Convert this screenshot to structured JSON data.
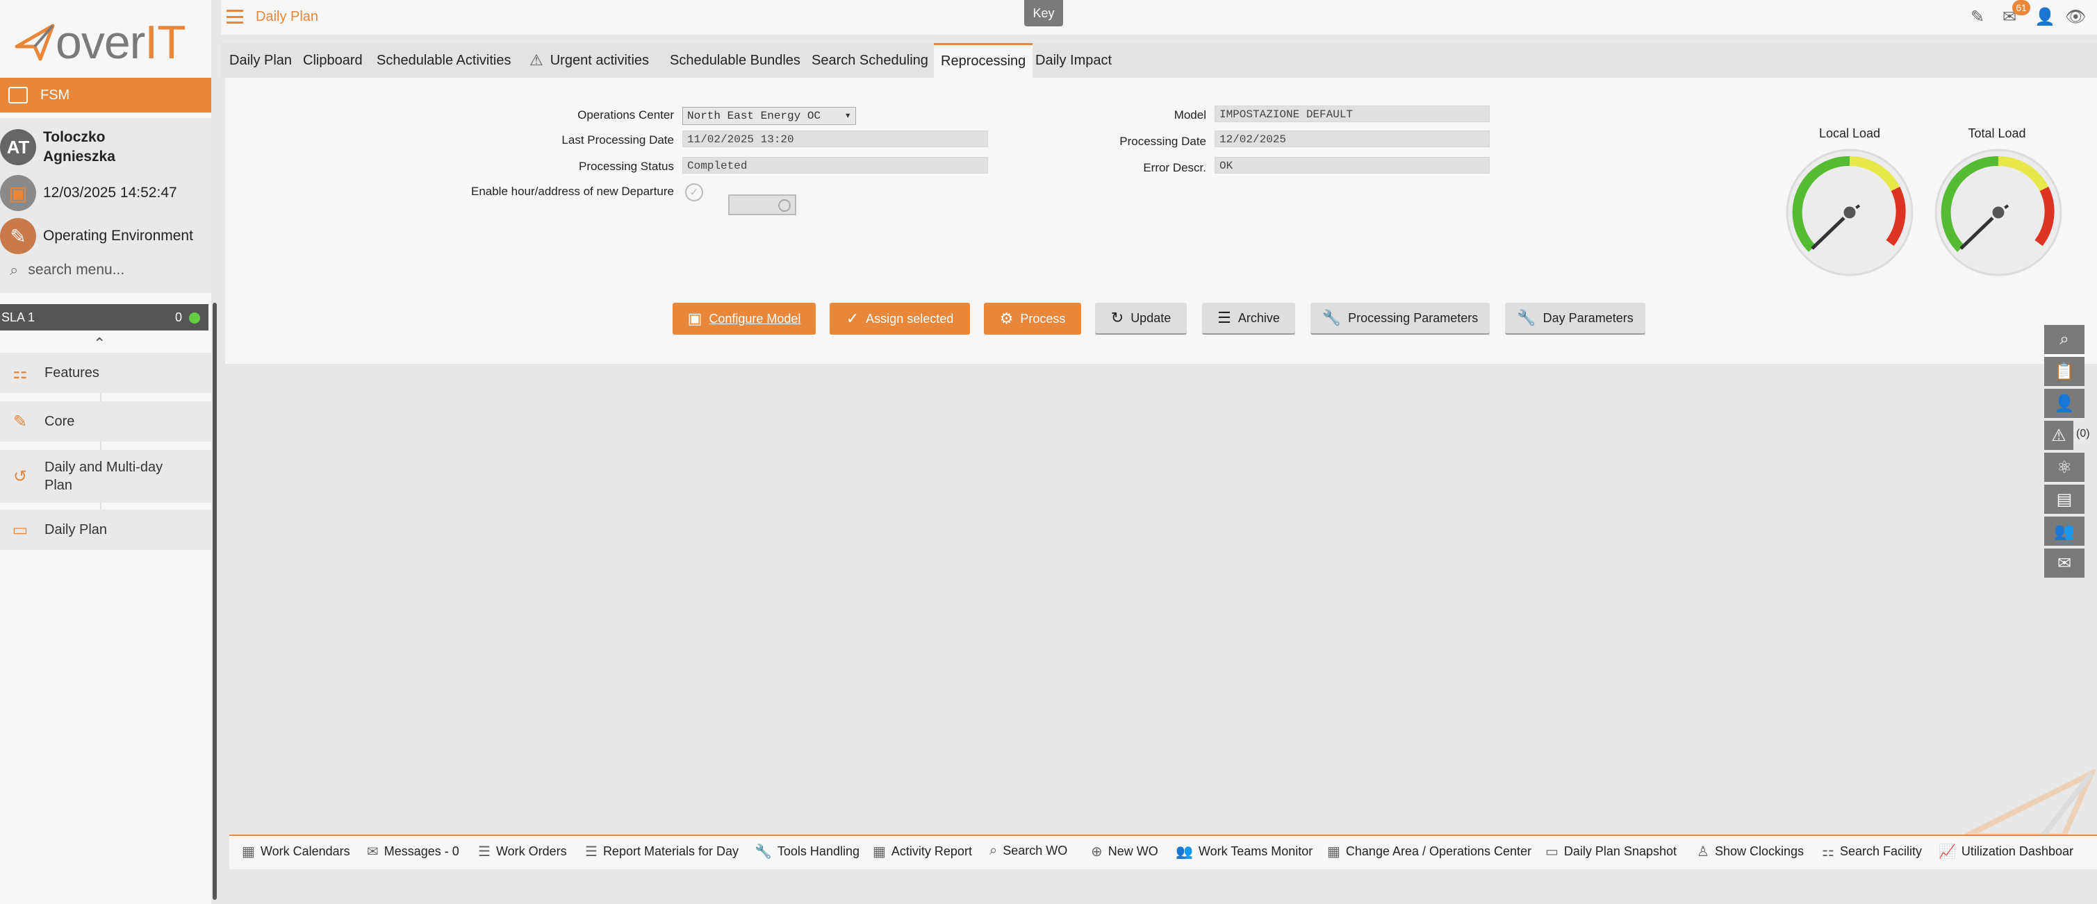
{
  "brand": {
    "logo_main": "over",
    "logo_accent": "IT"
  },
  "sidebar": {
    "module": "FSM",
    "user_initials": "AT",
    "user_name_line1": "Toloczko",
    "user_name_line2": "Agnieszka",
    "datetime": "12/03/2025 14:52:47",
    "environment": "Operating Environment",
    "search_placeholder": "search menu...",
    "sla_label": "SLA 1",
    "sla_count": "0",
    "items": [
      {
        "label": "Features",
        "icon": "features-icon"
      },
      {
        "label": "Core",
        "icon": "core-icon"
      },
      {
        "label": "Daily and Multi-day Plan",
        "icon": "history-icon"
      },
      {
        "label": "Daily Plan",
        "icon": "book-icon"
      }
    ]
  },
  "header": {
    "title": "Daily Plan",
    "key_label": "Key",
    "message_badge": "61"
  },
  "tabs": [
    "Daily Plan",
    "Clipboard",
    "Schedulable Activities",
    "Urgent activities",
    "Schedulable Bundles",
    "Search Scheduling",
    "Reprocessing",
    "Daily Impact"
  ],
  "active_tab": "Reprocessing",
  "form": {
    "operations_center_label": "Operations Center",
    "operations_center_value": "North East Energy OC",
    "last_processing_label": "Last Processing Date",
    "last_processing_value": "11/02/2025 13:20",
    "status_label": "Processing Status",
    "status_value": "Completed",
    "enable_label": "Enable hour/address of new Departure",
    "model_label": "Model",
    "model_value": "IMPOSTAZIONE DEFAULT",
    "processing_date_label": "Processing Date",
    "processing_date_value": "12/02/2025",
    "error_label": "Error Descr.",
    "error_value": "OK"
  },
  "buttons": {
    "configure_model": "Configure Model",
    "assign_selected": "Assign selected",
    "process": "Process",
    "update": "Update",
    "archive": "Archive",
    "processing_parameters": "Processing Parameters",
    "day_parameters": "Day Parameters"
  },
  "gauges": {
    "local_label": "Local Load",
    "total_label": "Total Load",
    "colors": {
      "green": "#55bb33",
      "yellow": "#e8e84a",
      "red": "#dd3322"
    }
  },
  "right_toolbar": {
    "alerts_count": "(0)"
  },
  "bottom_bar": [
    {
      "label": "Work Calendars",
      "icon": "calendar-icon"
    },
    {
      "label": "Messages - 0",
      "icon": "mail-icon"
    },
    {
      "label": "Work Orders",
      "icon": "list-icon"
    },
    {
      "label": "Report Materials for Day",
      "icon": "list-icon"
    },
    {
      "label": "Tools Handling",
      "icon": "wrench-icon"
    },
    {
      "label": "Activity Report",
      "icon": "table-icon"
    },
    {
      "label": "Search WO",
      "icon": "search-icon"
    },
    {
      "label": "New WO",
      "icon": "plus-circle-icon"
    },
    {
      "label": "Work Teams Monitor",
      "icon": "team-icon"
    },
    {
      "label": "Change Area / Operations Center",
      "icon": "grid-icon"
    },
    {
      "label": "Daily Plan Snapshot",
      "icon": "book-icon"
    },
    {
      "label": "Show Clockings",
      "icon": "stamp-icon"
    },
    {
      "label": "Search Facility",
      "icon": "features-icon"
    },
    {
      "label": "Utilization Dashboard",
      "icon": "chart-icon"
    }
  ],
  "colors": {
    "accent": "#e8873a",
    "panel": "#f7f7f7",
    "background": "#e8e8e8"
  }
}
